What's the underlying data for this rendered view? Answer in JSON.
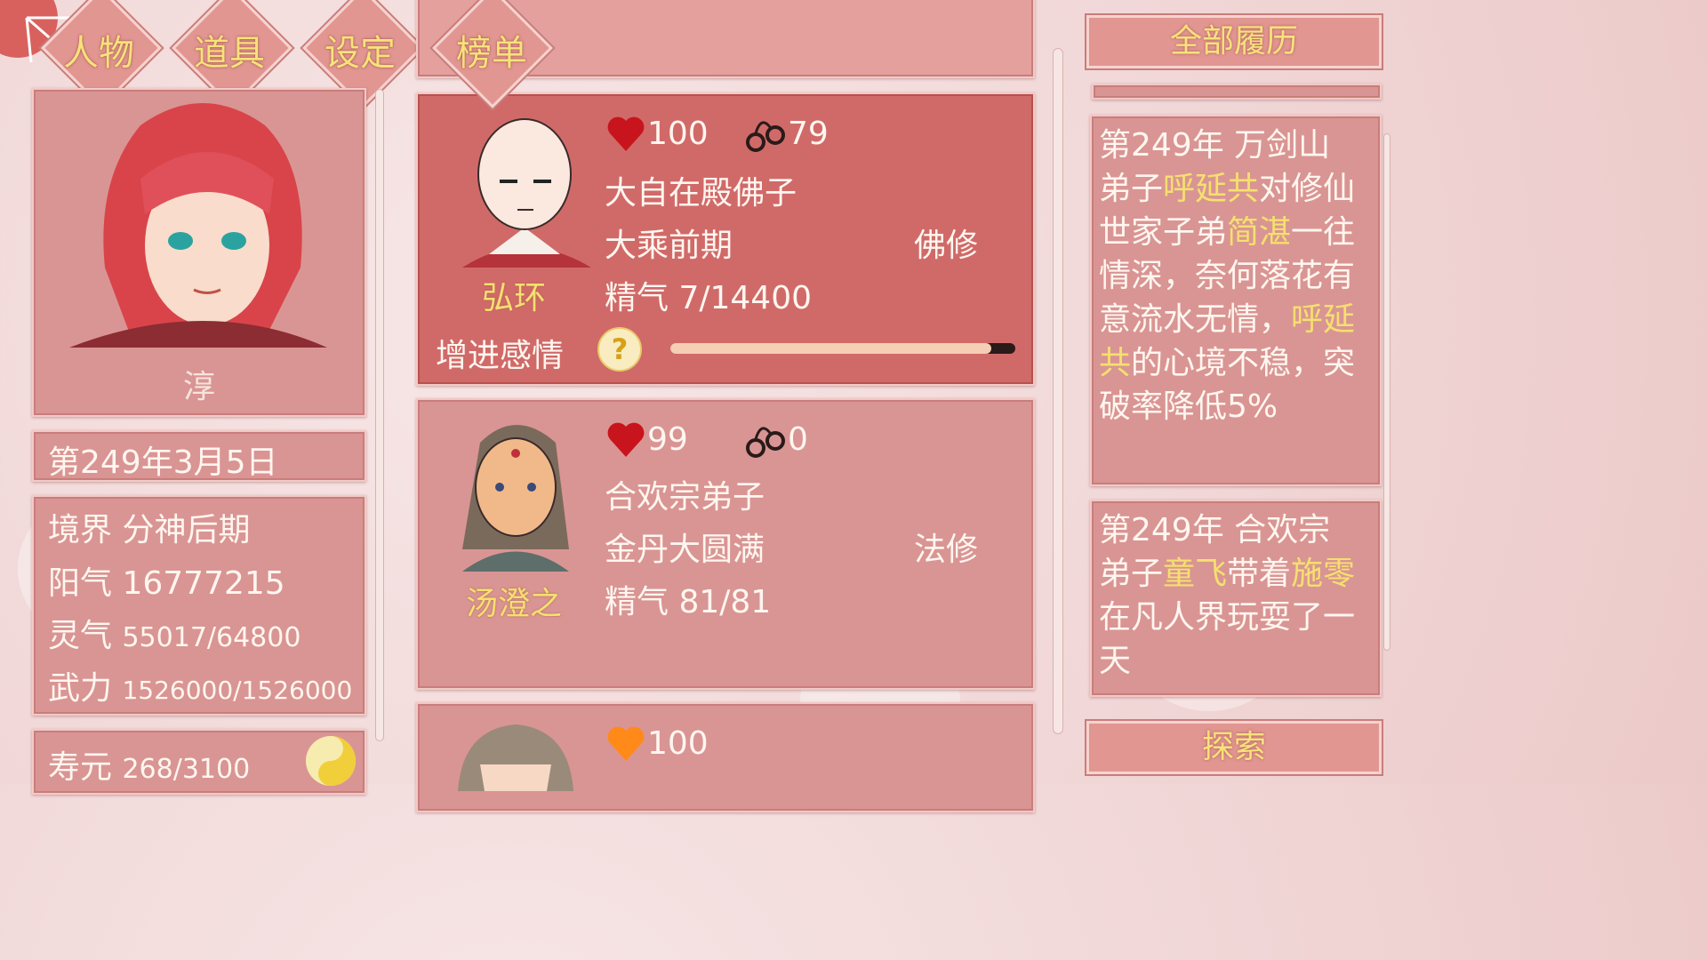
{
  "tabs": [
    {
      "label": "人物"
    },
    {
      "label": "道具"
    },
    {
      "label": "设定"
    },
    {
      "label": "榜单"
    }
  ],
  "player": {
    "name": "淳",
    "date": "第249年3月5日",
    "realm_label": "境界",
    "realm": "分神后期",
    "yang_label": "阳气",
    "yang": "16777215",
    "ling_label": "灵气",
    "ling": "55017/64800",
    "wu_label": "武力",
    "wu": "1526000/1526000",
    "life_label": "寿元",
    "life": "268/3100"
  },
  "characters": [
    {
      "name": "弘环",
      "affection": "100",
      "bond": "79",
      "title": "大自在殿佛子",
      "realm": "大乘前期",
      "school": "佛修",
      "essence": "精气 7/14400",
      "heart_color": "#c8141c"
    },
    {
      "name": "汤澄之",
      "affection": "99",
      "bond": "0",
      "title": "合欢宗弟子",
      "realm": "金丹大圆满",
      "school": "法修",
      "essence": "精气 81/81",
      "heart_color": "#c8141c"
    },
    {
      "name": "",
      "affection": "100",
      "bond": "",
      "title": "",
      "realm": "",
      "school": "",
      "essence": "",
      "heart_color": "#ff8a1a"
    }
  ],
  "enhance": {
    "label": "增进感情",
    "help": "?",
    "progress": 0.93
  },
  "right": {
    "history_button": "全部履历",
    "explore_button": "探索",
    "log1": {
      "p1": "第249年 万剑山弟子",
      "h1": "呼延共",
      "p2": "对修仙世家子弟",
      "h2": "简湛",
      "p3": "一往情深，奈何落花有意流水无情，",
      "h3": "呼延共",
      "p4": "的心境不稳，突破率降低5%"
    },
    "log2": {
      "p1": "第249年 合欢宗弟子",
      "h1": "童飞",
      "p2": "带着",
      "h2": "施零",
      "p3": "在凡人界玩耍了一天"
    }
  },
  "colors": {
    "highlight": "#f5e06f",
    "panel": "#d99593",
    "selected": "#d06a68"
  }
}
